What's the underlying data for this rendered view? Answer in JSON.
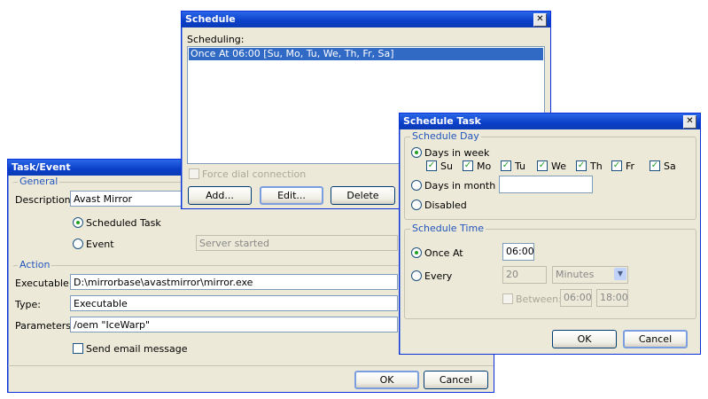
{
  "task_event": {
    "title": "Task/Event",
    "general_group": "General",
    "description_label": "Description:",
    "description_value": "Avast Mirror",
    "scheduled_task_label": "Scheduled Task",
    "event_label": "Event",
    "event_value": "Server started",
    "action_group": "Action",
    "executable_label": "Executable:",
    "executable_value": "D:\\mirrorbase\\avastmirror\\mirror.exe",
    "type_label": "Type:",
    "type_value": "Executable",
    "parameters_label": "Parameters:",
    "parameters_value": "/oem \"IceWarp\"",
    "send_email_label": "Send email message",
    "ok_label": "OK",
    "cancel_label": "Cancel"
  },
  "schedule": {
    "title": "Schedule",
    "scheduling_label": "Scheduling:",
    "items": [
      "Once At 06:00 [Su, Mo, Tu, We, Th, Fr, Sa]"
    ],
    "force_dial_label": "Force dial connection",
    "add_label": "Add...",
    "edit_label": "Edit...",
    "delete_label": "Delete"
  },
  "schedule_task": {
    "title": "Schedule Task",
    "schedule_day_group": "Schedule Day",
    "days_in_week_label": "Days in week",
    "days": [
      "Su",
      "Mo",
      "Tu",
      "We",
      "Th",
      "Fr",
      "Sa"
    ],
    "days_in_month_label": "Days in month",
    "disabled_label": "Disabled",
    "schedule_time_group": "Schedule Time",
    "once_at_label": "Once At",
    "once_at_value": "06:00",
    "every_label": "Every",
    "every_value": "20",
    "every_unit": "Minutes",
    "between_label": "Between:",
    "between_from": "06:00",
    "between_to": "18:00",
    "ok_label": "OK",
    "cancel_label": "Cancel"
  },
  "colors": {
    "titlebar": "#0a3fc8",
    "dialog_bg": "#ece9d8",
    "selection": "#316ac5",
    "group_title": "#2255bb"
  }
}
